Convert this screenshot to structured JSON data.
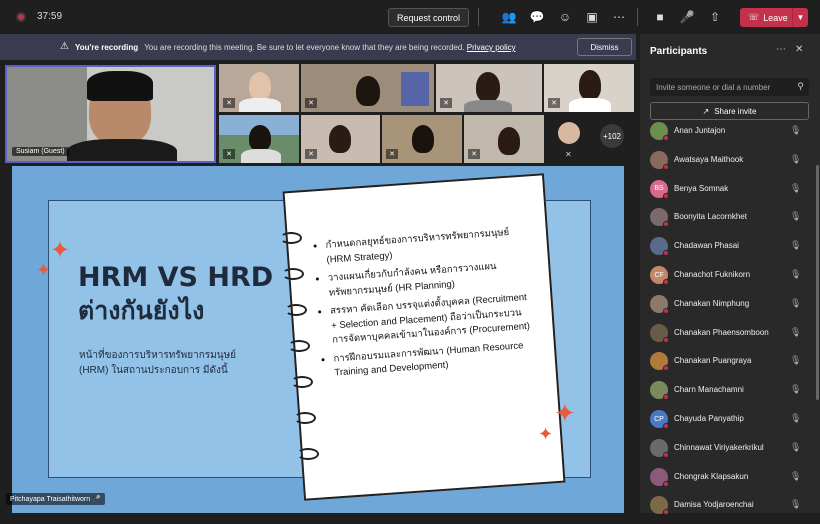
{
  "toolbar": {
    "timer": "37:59",
    "request_control": "Request control",
    "leave": "Leave"
  },
  "recording": {
    "bold": "You're recording",
    "text": "You are recording this meeting. Be sure to let everyone know that they are being recorded.",
    "link": "Privacy policy",
    "dismiss": "Dismiss"
  },
  "gallery": {
    "speaker_name": "Susiam (Guest)",
    "overflow": "+102"
  },
  "slide": {
    "title1": "HRM VS HRD",
    "title2": "ต่างกันยังไง",
    "subtitle": "หน้าที่ของการบริหารทรัพยากรมนุษย์ (HRM) ในสถานประกอบการ มีดังนี้",
    "bullets": [
      "กำหนดกลยุทธ์ของการบริหารทรัพยากรมนุษย์ (HRM Strategy)",
      "วางแผนเกี่ยวกับกำลังคน หรือการวางแผนทรัพยากรมนุษย์ (HR Planning)",
      "สรรหา คัดเลือก บรรจุแต่งตั้งบุคคล (Recruitment + Selection and Placement) ถือว่าเป็นกระบวนการจัดหาบุคคลเข้ามาในองค์การ (Procurement)",
      "การฝึกอบรมและการพัฒนา (Human Resource Training and Development)"
    ],
    "presenter": "Pitchayapa Traisathitworn"
  },
  "panel": {
    "title": "Participants",
    "invite_placeholder": "Invite someone or dial a number",
    "share_invite": "Share invite",
    "participants": [
      {
        "name": "Anan Juntajon",
        "initials": "",
        "color": "#6b8e4e"
      },
      {
        "name": "Awatsaya Maithook",
        "initials": "",
        "color": "#8a6a5a"
      },
      {
        "name": "Benya Somnak",
        "initials": "BS",
        "color": "#d96a8c"
      },
      {
        "name": "Boonyita Lacornkhet",
        "initials": "",
        "color": "#7a6a6a"
      },
      {
        "name": "Chadawan Phasai",
        "initials": "",
        "color": "#5a6a8a"
      },
      {
        "name": "Chanachot Fuknikorn",
        "initials": "CF",
        "color": "#c4866a"
      },
      {
        "name": "Chanakan Nimphung",
        "initials": "",
        "color": "#8a7a6a"
      },
      {
        "name": "Chanakan Phaensomboon",
        "initials": "",
        "color": "#6a5a4a"
      },
      {
        "name": "Chanakan Puangraya",
        "initials": "",
        "color": "#b07a3a"
      },
      {
        "name": "Charn Manachamni",
        "initials": "",
        "color": "#7a8a5a"
      },
      {
        "name": "Chayuda Panyathip",
        "initials": "CP",
        "color": "#4a7ac4"
      },
      {
        "name": "Chinnawat Viriyakerkrikul",
        "initials": "",
        "color": "#6a6a6a"
      },
      {
        "name": "Chongrak Klapsakun",
        "initials": "",
        "color": "#8a5a7a"
      },
      {
        "name": "Damisa Yodjaroenchai",
        "initials": "",
        "color": "#7a6a4a"
      }
    ]
  }
}
